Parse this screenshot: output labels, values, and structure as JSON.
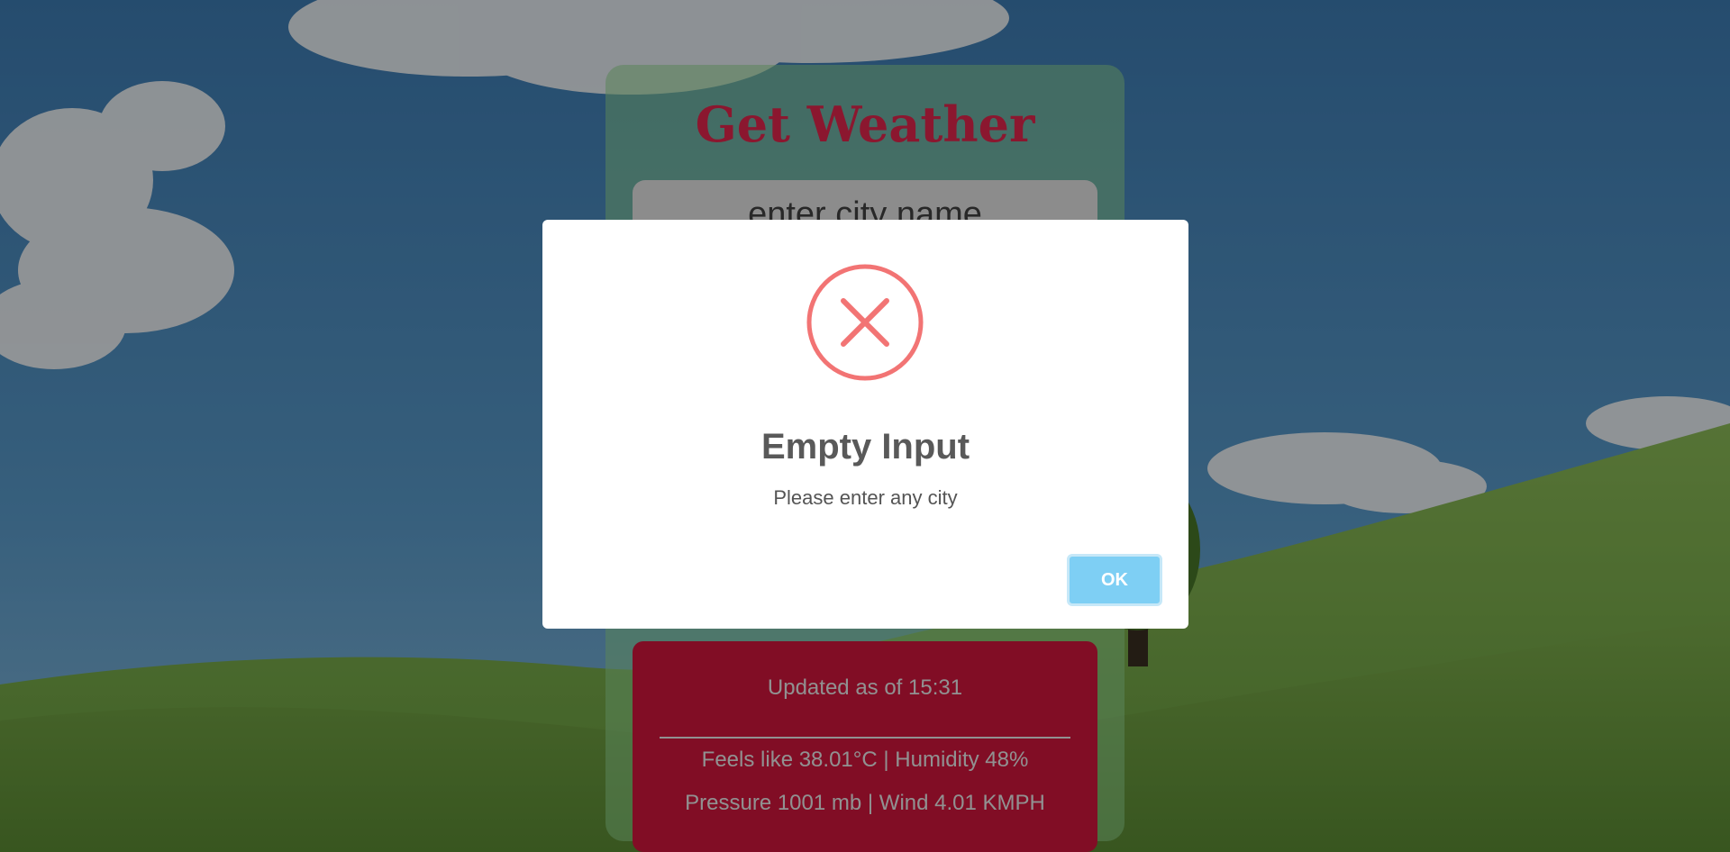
{
  "weather_card": {
    "title": "Get Weather",
    "city_input": {
      "placeholder": "enter city name",
      "value": ""
    },
    "result": {
      "updated": "Updated as of 15:31",
      "feels_like_line": "Feels like 38.01°C | Humidity 48%",
      "pressure_line": "Pressure 1001 mb | Wind 4.01 KMPH"
    }
  },
  "modal": {
    "icon": "error-x-icon",
    "title": "Empty Input",
    "text": "Please enter any city",
    "ok_label": "OK"
  },
  "colors": {
    "title_red": "#e8274f",
    "result_red": "#d8163f",
    "error_icon": "#f27474",
    "ok_button": "#7ecff4"
  }
}
